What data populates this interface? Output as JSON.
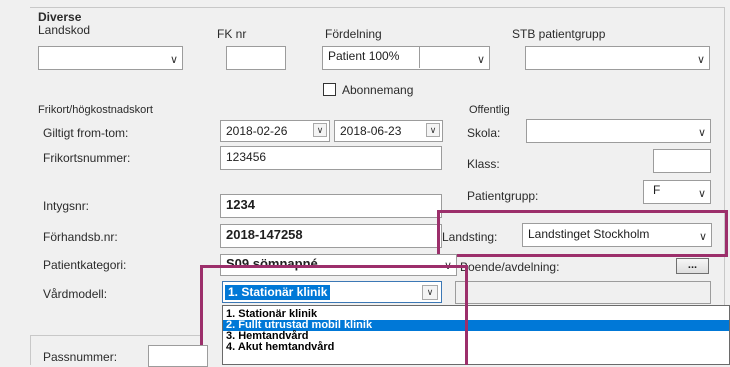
{
  "section_title": "Diverse",
  "top_row": {
    "landskod_label": "Landskod",
    "landskod_value": "",
    "fknr_label": "FK nr",
    "fknr_value": "",
    "fordelning_label": "Fördelning",
    "fordelning_value": "Patient 100%",
    "stb_label": "STB patientgrupp",
    "stb_value": ""
  },
  "abonnemang_label": "Abonnemang",
  "frikort": {
    "title": "Frikort/högkostnadskort",
    "giltigt_label": "Giltigt from-tom:",
    "from_date": "2018-02-26",
    "tom_date": "2018-06-23",
    "nummer_label": "Frikortsnummer:",
    "nummer_value": "123456"
  },
  "offentlig": {
    "title": "Offentlig",
    "skola_label": "Skola:",
    "skola_value": "",
    "klass_label": "Klass:",
    "klass_value": "",
    "patientgrupp_label": "Patientgrupp:",
    "patientgrupp_value": "F"
  },
  "intyg_label": "Intygsnr:",
  "intyg_value": "1234",
  "forhandsb_label": "Förhandsb.nr:",
  "forhandsb_value": "2018-147258",
  "landsting_label": "Landsting:",
  "landsting_value": "Landstinget Stockholm",
  "patientkategori_label": "Patientkategori:",
  "patientkategori_value": "S09 sömnapné",
  "boende_label": "Boende/avdelning:",
  "boende_btn": "...",
  "vardmodell_label": "Vårdmodell:",
  "vardmodell_value": "1. Stationär klinik",
  "vardmodell_options": [
    "1. Stationär klinik",
    "2. Fullt utrustad mobil klinik",
    "3. Hemtandvård",
    "4. Akut hemtandvård"
  ],
  "passnummer_label": "Passnummer:",
  "colors": {
    "highlight": "#9c2f6b",
    "selection": "#0078d7"
  }
}
